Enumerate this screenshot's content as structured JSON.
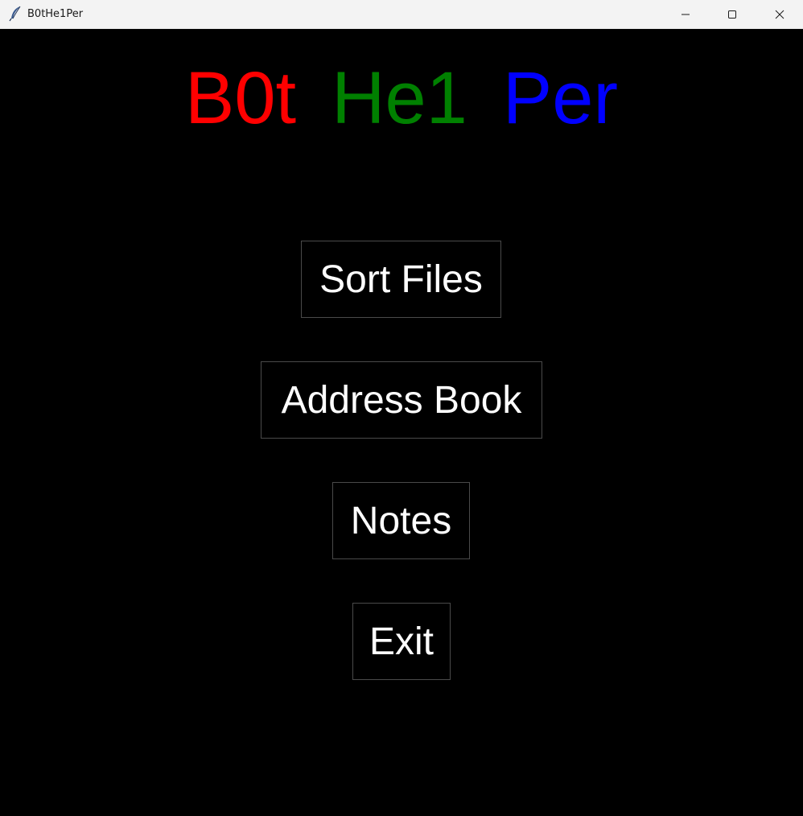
{
  "window": {
    "title": "B0tHe1Per",
    "icon": "feather-icon",
    "controls": [
      "minimize-icon",
      "maximize-icon",
      "close-icon"
    ]
  },
  "heading": {
    "part1": {
      "text": "B0t",
      "color": "#ff0000"
    },
    "part2": {
      "text": "He1",
      "color": "#008000"
    },
    "part3": {
      "text": "Per",
      "color": "#0000ff"
    }
  },
  "menu": {
    "sort_files": "Sort Files",
    "address_book": "Address Book",
    "notes": "Notes",
    "exit": "Exit"
  },
  "colors": {
    "background": "#000000",
    "button_text": "#ffffff",
    "button_border": "#4a4a4a"
  }
}
